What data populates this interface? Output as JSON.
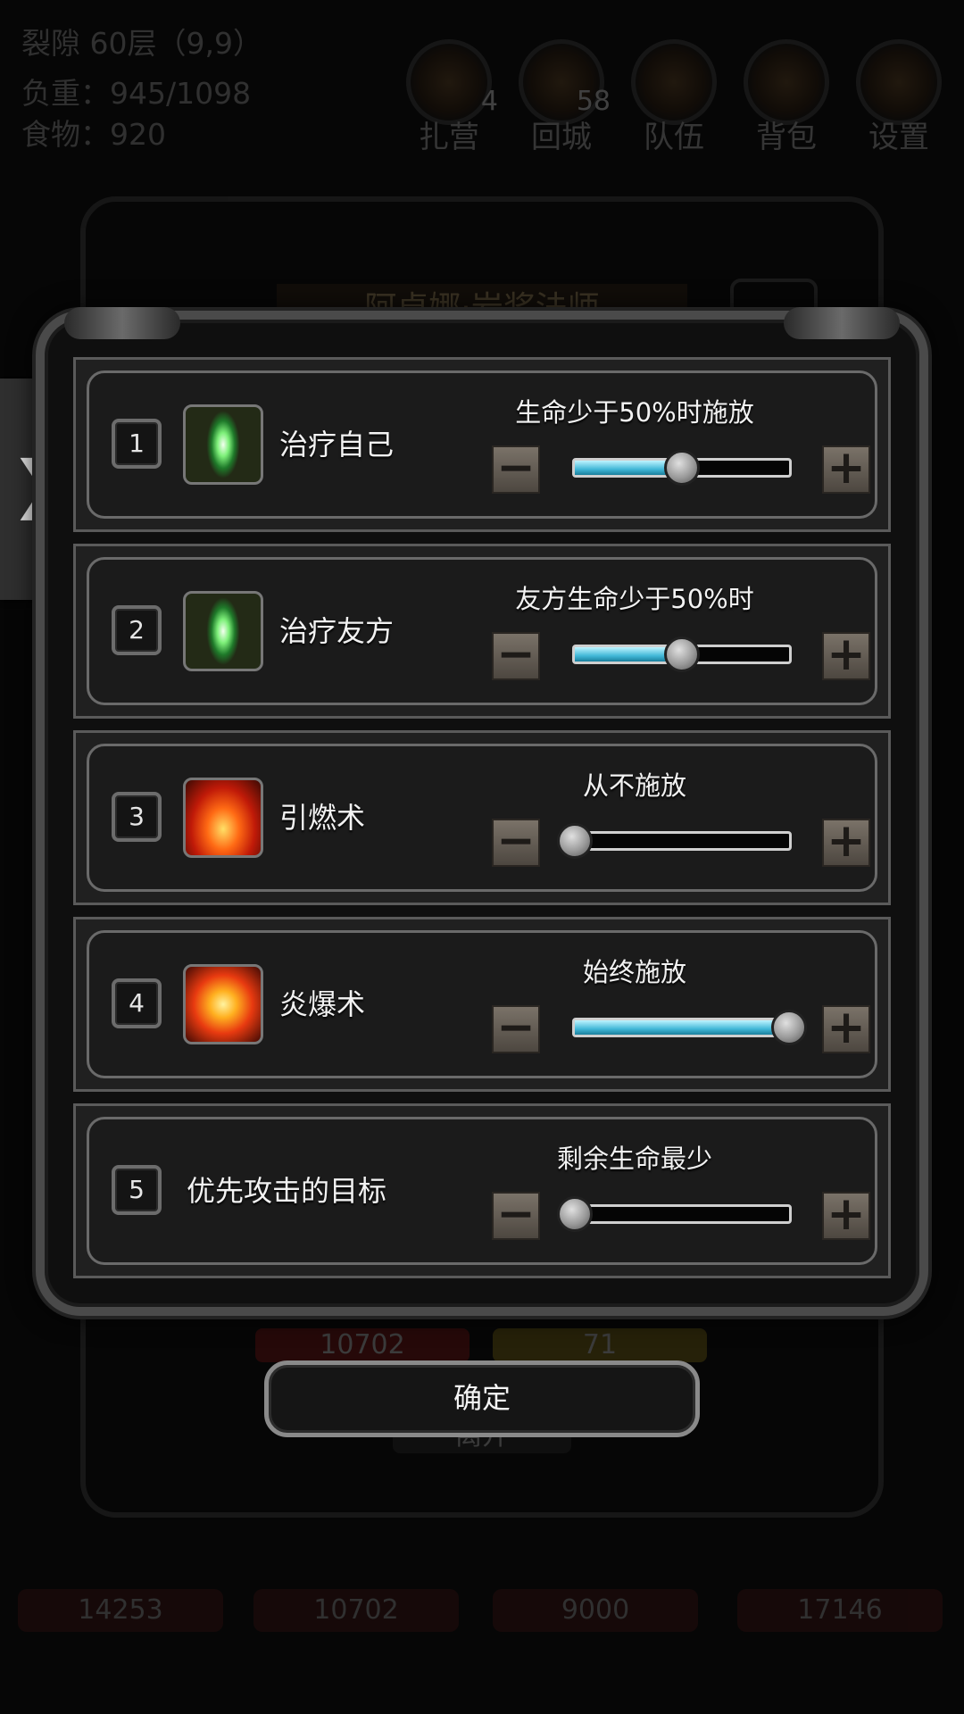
{
  "background": {
    "location": "裂隙 60层（9,9）",
    "load": "负重：945/1098",
    "food": "食物：920",
    "hud_buttons": [
      {
        "label": "扎营",
        "icon": "camp-icon",
        "badge": "4"
      },
      {
        "label": "回城",
        "icon": "portal-icon",
        "badge": "58"
      },
      {
        "label": "队伍",
        "icon": "team-icon",
        "badge": ""
      },
      {
        "label": "背包",
        "icon": "bag-icon",
        "badge": ""
      },
      {
        "label": "设置",
        "icon": "gear-icon",
        "badge": ""
      }
    ],
    "hero_name": "阿卓娜·岩浆法师",
    "hp_value": "10702",
    "energy_value": "71",
    "leave_label": "离开",
    "party_hp": [
      "14253",
      "10702",
      "9000",
      "17146"
    ]
  },
  "side_tab": {
    "glyph": "❯"
  },
  "rules": [
    {
      "index": "1",
      "name": "治疗自己",
      "icon": "heal-icon",
      "condition": "生命少于50%时施放",
      "level": 0.5
    },
    {
      "index": "2",
      "name": "治疗友方",
      "icon": "heal-icon",
      "condition": "友方生命少于50%时",
      "level": 0.5
    },
    {
      "index": "3",
      "name": "引燃术",
      "icon": "fire-icon",
      "condition": "从不施放",
      "level": 0
    },
    {
      "index": "4",
      "name": "炎爆术",
      "icon": "explosion-icon",
      "condition": "始终施放",
      "level": 1
    },
    {
      "index": "5",
      "name": "优先攻击的目标",
      "icon": "",
      "condition": "剩余生命最少",
      "level": 0
    }
  ],
  "controls": {
    "minus": "−",
    "plus": "+"
  },
  "confirm_label": "确定",
  "colors": {
    "slider_fill": "#42b8d8",
    "dialog_border": "#4a4a4a"
  }
}
